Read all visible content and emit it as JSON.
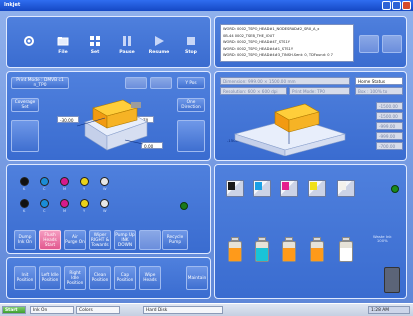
{
  "window": {
    "title": "Inkjet"
  },
  "toolbar": [
    {
      "label": "",
      "icon": "gear-icon"
    },
    {
      "label": "File",
      "icon": "folder-icon"
    },
    {
      "label": "Set",
      "icon": "settings-icon"
    },
    {
      "label": "Pause",
      "icon": "pause-icon"
    },
    {
      "label": "Resume",
      "icon": "play-icon"
    },
    {
      "label": "Stop",
      "icon": "stop-icon"
    }
  ],
  "log": {
    "lines": [
      "WORD: 0002_TSPO_HEAD#1_NODESRAD#2_SRX_A_x",
      "0B-44 0002_TSEB_THE_IOUT",
      "WORD: 0002_TSPO_HEAD#4T_STS1Y",
      "WORD: 0002_TSPO_HEAD#4#1_STS1Y",
      "WORD: 0002_TSPO_HEAD#4#3_TINSH.Sent: 0, TDFound: 0 7"
    ]
  },
  "print": {
    "mode_label": "Print Mode : DMVB c1 n_TP0",
    "btn_a": "",
    "btn_b": "",
    "btn_c": "Y Pos",
    "coverage_label": "Coverage\nSet",
    "one_dir_label": "One\nDirection",
    "field_x": "-30,00",
    "field_y": "0.70",
    "field_z": "0.00"
  },
  "head": {
    "dimension": "Dimension: 999.00 × 1500.00 mm",
    "resolution": "Resolution: 600 × 600 dpi",
    "print_mode": "Print Mode: TP0",
    "home_status": "Home Status",
    "home_value": "Box : 100% to",
    "fields": [
      "-1500.00",
      "-1500.00",
      "-999.00",
      "-999.00",
      "-700.00"
    ],
    "field_left": "-1500.00",
    "field_right": "-1500.00"
  },
  "nozzles": {
    "colors": [
      "#111111",
      "#1a8cd6",
      "#d61a8c",
      "#e8d21a",
      "#e6e6e6",
      "#111111",
      "#1a8cd6",
      "#d61a8c",
      "#e8d21a",
      "#e6e6e6"
    ],
    "labels": [
      "K",
      "C",
      "M",
      "Y",
      "W",
      "K",
      "C",
      "M",
      "Y",
      "W"
    ],
    "status_color": "#1a7a1a"
  },
  "actions": [
    "Dump\nInk On",
    "Flush\nHeads\nStart",
    "Air\nPurge On",
    "Wiper\nRIGHT &\nTowards",
    "Pump Up\nINK\nDOWN",
    "",
    "Recycle\nPump"
  ],
  "motion": [
    "Init\nPosition",
    "Left Idle\nPosition",
    "Right\nIdle\nPosition",
    "Clean\nPosition",
    "Cap\nPosition",
    "Wipe\nHeads",
    "Maintain"
  ],
  "ink": {
    "carts": [
      "#1a1a1a",
      "#1aa0e6",
      "#e6208c",
      "#f0e01a",
      "#f4f2ec"
    ],
    "bottles": [
      "#ff9a1a",
      "#19c4d8",
      "#ff9a1a",
      "#ff9a1a",
      "#ffffff"
    ],
    "waste_label": "Waste Ink\n100%",
    "status_color": "#1a8a1a"
  },
  "taskbar": {
    "start": "Start",
    "items": [
      "Ink On",
      "Colors"
    ],
    "disk": "Hard Disk",
    "clock": "1:28 AM"
  }
}
